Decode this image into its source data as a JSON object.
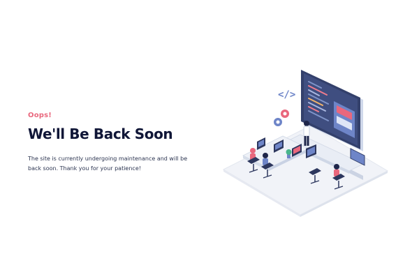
{
  "page": {
    "eyebrow": "Oops!",
    "headline": "We'll Be Back Soon",
    "body": "The site is currently undergoing maintenance and will be back soon. Thank you for your patience!"
  },
  "illustration": {
    "name": "office-maintenance-illustration",
    "icons": [
      "code-brackets-icon",
      "gear-icon",
      "monitor-icon",
      "chair-icon",
      "person-icon"
    ]
  },
  "colors": {
    "eyebrow_pink": "#e9677d",
    "headline_navy": "#101637",
    "body_text": "#2b3450",
    "accent_blue": "#4a6cf7",
    "floor": "#f1f3f8"
  }
}
